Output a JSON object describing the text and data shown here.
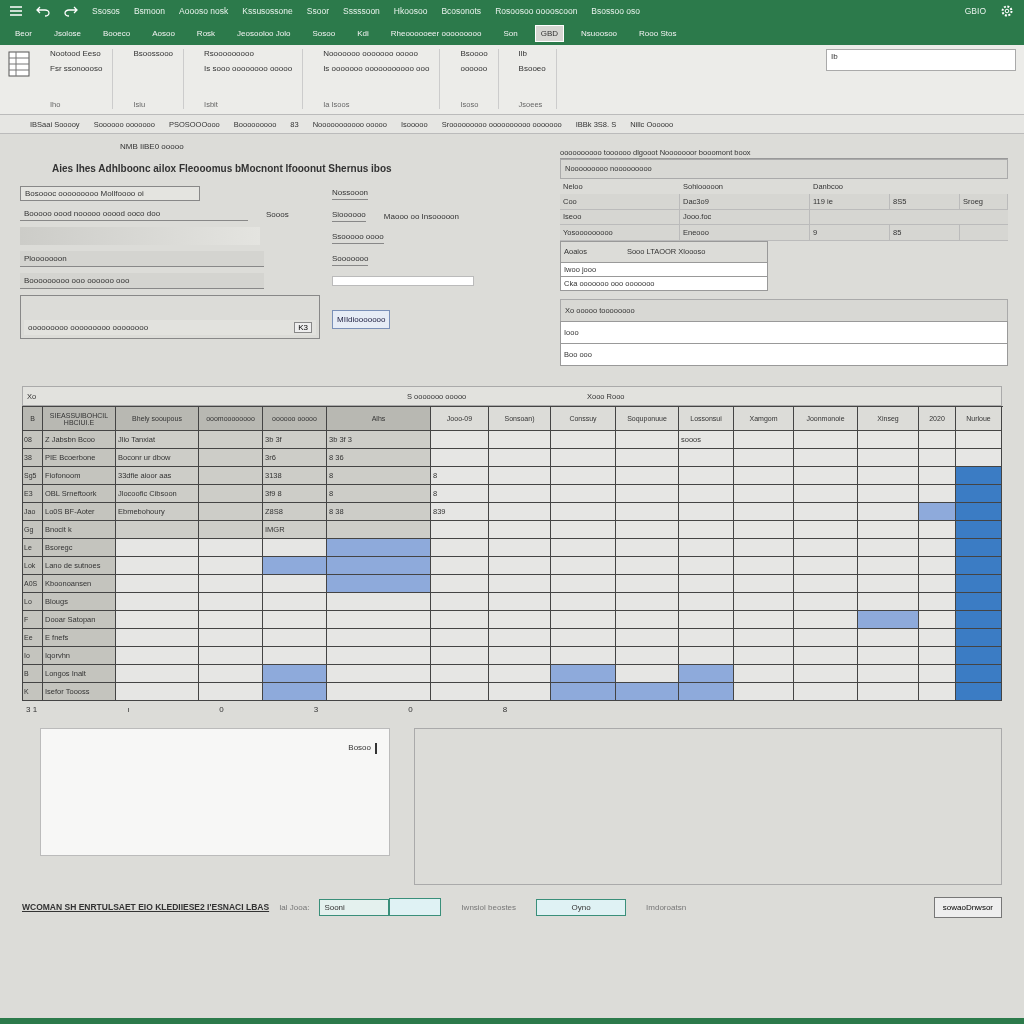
{
  "menu_bar": {
    "items": [
      "Ssosos",
      "Bsmoon",
      "Aoooso nosk",
      "Kssusossone",
      "Ssoor",
      "Sssssoon",
      "Hkoosoo",
      "Bcosonots",
      "Rosoosoo ooooscoon",
      "Bsossoo oso"
    ],
    "right_text": "GBIO"
  },
  "tabs": [
    {
      "label": "Beor",
      "selected": false
    },
    {
      "label": "Jsolose",
      "selected": false
    },
    {
      "label": "Booeco",
      "selected": false
    },
    {
      "label": "Aosoo",
      "selected": false
    },
    {
      "label": "Rosk",
      "selected": false
    },
    {
      "label": "Jeosooloo Jolo",
      "selected": false
    },
    {
      "label": "Sosoo",
      "selected": false
    },
    {
      "label": "Kdi",
      "selected": false
    },
    {
      "label": "Rheoooooeer ooooooooo",
      "selected": false
    },
    {
      "label": "Son",
      "selected": false
    },
    {
      "label": "GBD",
      "selected": true
    },
    {
      "label": "Nsuoosoo",
      "selected": false
    },
    {
      "label": "Rooo Stos",
      "selected": false
    }
  ],
  "ribbon": {
    "groups": [
      {
        "lines": [
          "Nootood Eeso",
          "Fsr ssonoooso"
        ],
        "caption": "Iho"
      },
      {
        "lines": [
          "Bsoossooo"
        ],
        "caption": "Isiu"
      },
      {
        "lines": [
          "Rsooooooooo",
          "Is sooo oooooooo ooooo"
        ],
        "caption": "Isbit"
      },
      {
        "lines": [
          "Nooooooo ooooooo ooooo",
          "Is ooooooo ooooooooooo ooo"
        ],
        "caption": "Ia  Isoos"
      },
      {
        "lines": [
          "Bsoooo",
          "oooooo"
        ],
        "caption": "Isoso"
      },
      {
        "lines": [
          "Ilb",
          "Bsooeo"
        ],
        "caption": "Jsoees"
      }
    ],
    "field_value": "Ib"
  },
  "formula_bar": [
    "IBSaai Sooooy",
    "Soooooo ooooooo",
    "PSOSOOOooo",
    "Booooooooo",
    "83",
    "Nooooooooooo ooooo",
    "Isooooo",
    "Srooooooooo oooooooooo ooooooo",
    "IBBk 3S8. S",
    "Nillc Oooooo"
  ],
  "form": {
    "note": "NMB IiBE0 ooooo",
    "title": "Aies Ihes Adhlboonc ailox Fleooomus bMocnont Ifooonut Shernus ibos",
    "fields_left": [
      "Bosoooc ooooooooo Mollfoooo oi",
      "Booooo oood nooooo ooood ooco doo"
    ],
    "side_label": "Sooos",
    "inputs": [
      "Plooooooon",
      "Booooooooo ooo oooooo ooo"
    ],
    "box_text": "ooooooooo ooooooooo  oooooooo",
    "box_button": "K3",
    "fields_right": [
      "Nossooon",
      "Sioooooo",
      "Ssooooo oooo",
      "Sooooooo"
    ],
    "right_note": "Maooo oo Insooooon",
    "action": "MIIdiooooooo"
  },
  "panel": {
    "heading": "oooooooooo toooooo dlgooot Nooooooor booomont boox",
    "subheading": "Nooooooooo nooooooooo",
    "columns": [
      "Neloo",
      "Sohiooooon",
      "Danbcoo"
    ],
    "rows": [
      [
        "Coo",
        "Dac3o9",
        "119 ie",
        "8S5",
        "Sroeg"
      ],
      [
        "Iseoo",
        "Jooo.foc"
      ],
      [
        "Yosooooooooo",
        "Eneooo",
        "9",
        "85"
      ]
    ],
    "group_title": "Aoaios",
    "group_value": "Sooo LTAOOR Xloooso",
    "lines": [
      "Iwoo jooo",
      "Cka ooooooo ooo ooooooo"
    ],
    "section": "Xo ooooo toooooooo",
    "inputs": [
      "Iooo",
      "Boo ooo"
    ]
  },
  "grid": {
    "caption_left": "Xo",
    "caption_mid": "S ooooooo ooooo",
    "caption_center": "Xooo Rooo",
    "columns": [
      "B",
      "SIEASSUIBOHCIL HBCIUI.E",
      "Bhely sooupous",
      "ooomoooooooo",
      "oooooo ooooo",
      "Alhs",
      "Jooo-09",
      "Sonsoan)",
      "Conssuy",
      "Soquponuue",
      "Lossonsui",
      "Xamgom",
      "Joonmonoie",
      "Xinseg",
      "2020",
      "Nurloue"
    ],
    "rows": [
      {
        "cells": [
          "08",
          "Z Jabsbn Bcoo",
          "Jlio Tanxiat",
          null,
          "3b 3f",
          "3b 3f  3",
          null,
          null,
          null,
          null,
          "sooos",
          null,
          null,
          null,
          null,
          null
        ],
        "selected": [
          false,
          false,
          false,
          false,
          false,
          false,
          false,
          false,
          false,
          false,
          false,
          false,
          false,
          false,
          false,
          false
        ]
      },
      {
        "cells": [
          "38",
          "PIE Bcoerbone",
          "Boconr ur dbow",
          null,
          "3r6",
          "8  36",
          null,
          null,
          null,
          null,
          null,
          null,
          null,
          null,
          null,
          null
        ],
        "selected": [
          false,
          false,
          false,
          false,
          false,
          false,
          false,
          false,
          false,
          false,
          false,
          false,
          false,
          false,
          false,
          false
        ]
      },
      {
        "cells": [
          "Sg5",
          "Fiofonoom",
          "33dfie aioor  aas",
          null,
          "3138",
          "8",
          "8",
          null,
          null,
          null,
          null,
          null,
          null,
          null,
          null,
          null
        ],
        "selected": [
          false,
          false,
          false,
          false,
          false,
          false,
          false,
          false,
          false,
          false,
          false,
          false,
          false,
          false,
          false,
          true
        ]
      },
      {
        "cells": [
          "E3",
          "OBL Srneftoork",
          "Jlocoofic Cibsoon",
          null,
          "3f9 8",
          "8",
          "8",
          null,
          null,
          null,
          null,
          null,
          null,
          null,
          null,
          null
        ],
        "selected": [
          false,
          false,
          false,
          false,
          false,
          false,
          false,
          false,
          false,
          false,
          false,
          false,
          false,
          false,
          false,
          true
        ]
      },
      {
        "cells": [
          "Jao",
          "Lo0S BF-Aoter",
          "Ebmebohoury",
          null,
          "Z8S8",
          "8  38",
          "839",
          null,
          null,
          null,
          null,
          null,
          null,
          null,
          null,
          null
        ],
        "selected": [
          false,
          false,
          false,
          false,
          false,
          false,
          false,
          false,
          false,
          false,
          false,
          false,
          false,
          false,
          true,
          true
        ]
      },
      {
        "cells": [
          "Gg",
          "Bnocit k",
          null,
          null,
          "IMGR",
          null,
          null,
          null,
          null,
          null,
          null,
          null,
          null,
          null,
          null,
          null
        ],
        "selected": [
          false,
          false,
          false,
          false,
          false,
          false,
          false,
          false,
          false,
          false,
          false,
          false,
          false,
          false,
          false,
          true
        ]
      },
      {
        "cells": [
          "Le",
          "Bsoregc",
          null,
          null,
          null,
          null,
          null,
          null,
          null,
          null,
          null,
          null,
          null,
          null,
          null,
          null
        ],
        "selected": [
          false,
          false,
          false,
          false,
          false,
          true,
          false,
          false,
          false,
          false,
          false,
          false,
          false,
          false,
          false,
          true
        ]
      },
      {
        "cells": [
          "Lok",
          "Lano de sutnoes",
          null,
          null,
          null,
          null,
          null,
          null,
          null,
          null,
          null,
          null,
          null,
          null,
          null,
          null
        ],
        "selected": [
          false,
          false,
          false,
          false,
          true,
          true,
          false,
          false,
          false,
          false,
          false,
          false,
          false,
          false,
          false,
          true
        ]
      },
      {
        "cells": [
          "A0S",
          "Kboonoansen",
          null,
          null,
          null,
          null,
          null,
          null,
          null,
          null,
          null,
          null,
          null,
          null,
          null,
          null
        ],
        "selected": [
          false,
          false,
          false,
          false,
          false,
          true,
          false,
          false,
          false,
          false,
          false,
          false,
          false,
          false,
          false,
          true
        ]
      },
      {
        "cells": [
          "Lo",
          "Blougs",
          null,
          null,
          null,
          null,
          null,
          null,
          null,
          null,
          null,
          null,
          null,
          null,
          null,
          null
        ],
        "selected": [
          false,
          false,
          false,
          false,
          false,
          false,
          false,
          false,
          false,
          false,
          false,
          false,
          false,
          false,
          false,
          true
        ]
      },
      {
        "cells": [
          "F",
          "Dooar Satopan",
          null,
          null,
          null,
          null,
          null,
          null,
          null,
          null,
          null,
          null,
          null,
          null,
          null,
          null
        ],
        "selected": [
          false,
          false,
          false,
          false,
          false,
          false,
          false,
          false,
          false,
          false,
          false,
          false,
          false,
          true,
          false,
          true
        ]
      },
      {
        "cells": [
          "Ee",
          "E fnefs",
          null,
          null,
          null,
          null,
          null,
          null,
          null,
          null,
          null,
          null,
          null,
          null,
          null,
          null
        ],
        "selected": [
          false,
          false,
          false,
          false,
          false,
          false,
          false,
          false,
          false,
          false,
          false,
          false,
          false,
          false,
          false,
          true
        ]
      },
      {
        "cells": [
          "Io",
          "Iqorvhn",
          null,
          null,
          null,
          null,
          null,
          null,
          null,
          null,
          null,
          null,
          null,
          null,
          null,
          null
        ],
        "selected": [
          false,
          false,
          false,
          false,
          false,
          false,
          false,
          false,
          false,
          false,
          false,
          false,
          false,
          false,
          false,
          true
        ]
      },
      {
        "cells": [
          "B",
          "Longos Inalt",
          null,
          null,
          null,
          null,
          null,
          null,
          null,
          null,
          null,
          null,
          null,
          null,
          null,
          null
        ],
        "selected": [
          false,
          false,
          false,
          false,
          true,
          false,
          false,
          false,
          true,
          false,
          true,
          false,
          false,
          false,
          false,
          true
        ]
      },
      {
        "cells": [
          "K",
          "Isefor Toooss",
          null,
          null,
          null,
          null,
          null,
          null,
          null,
          null,
          null,
          null,
          null,
          null,
          null,
          null
        ],
        "selected": [
          false,
          false,
          false,
          false,
          true,
          false,
          false,
          false,
          true,
          true,
          true,
          false,
          false,
          false,
          false,
          true
        ]
      }
    ],
    "footer": [
      "3 1",
      "ı",
      "0",
      "3",
      "0",
      "8"
    ]
  },
  "notes_box": {
    "text": "Bosoo"
  },
  "status_bar": {
    "summary": "WCOMAN  SH ENRTULSAET EIO KLEDIIESE2 I'ESNACI LBAS",
    "label": "Ial Jooa:",
    "field": "Sooni",
    "middle": "Iwnsiol beostes",
    "value": "Oyno",
    "right": "Imdoroatsn",
    "button": "sowaoDnwsor"
  }
}
